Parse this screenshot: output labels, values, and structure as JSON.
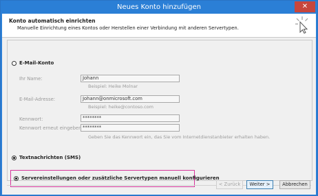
{
  "window": {
    "title": "Neues Konto hinzufügen",
    "close_glyph": "✕"
  },
  "header": {
    "title": "Konto automatisch einrichten",
    "subtitle": "Manuelle Einrichtung eines Kontos oder Herstellen einer Verbindung mit anderen Servertypen.",
    "icon": "cursor-click-icon"
  },
  "email_account": {
    "label": "E-Mail-Konto",
    "selected": false,
    "name_label": "Ihr Name:",
    "name_value": "Johann",
    "name_hint": "Beispiel: Heike Molnar",
    "email_label": "E-Mail-Adresse:",
    "email_value": "Johann@onmicrosoft.com",
    "email_hint": "Beispiel: heike@contoso.com",
    "password_label": "Kennwort:",
    "password_value": "********",
    "password_repeat_label": "Kennwort erneut eingeben:",
    "password_repeat_value": "********",
    "password_hint": "Geben Sie das Kennwort ein, das Sie vom Internetdienstanbieter erhalten haben."
  },
  "sms": {
    "label": "Textnachrichten (SMS)",
    "selected": true
  },
  "manual": {
    "label": "Servereinstellungen oder zusätzliche Servertypen manuell konfigurieren",
    "selected": true,
    "highlight_color": "#d6339a"
  },
  "buttons": {
    "back": "< Zurück",
    "next": "Weiter >",
    "cancel": "Abbrechen"
  },
  "colors": {
    "titlebar": "#2b7fd6",
    "close": "#c7463d"
  }
}
